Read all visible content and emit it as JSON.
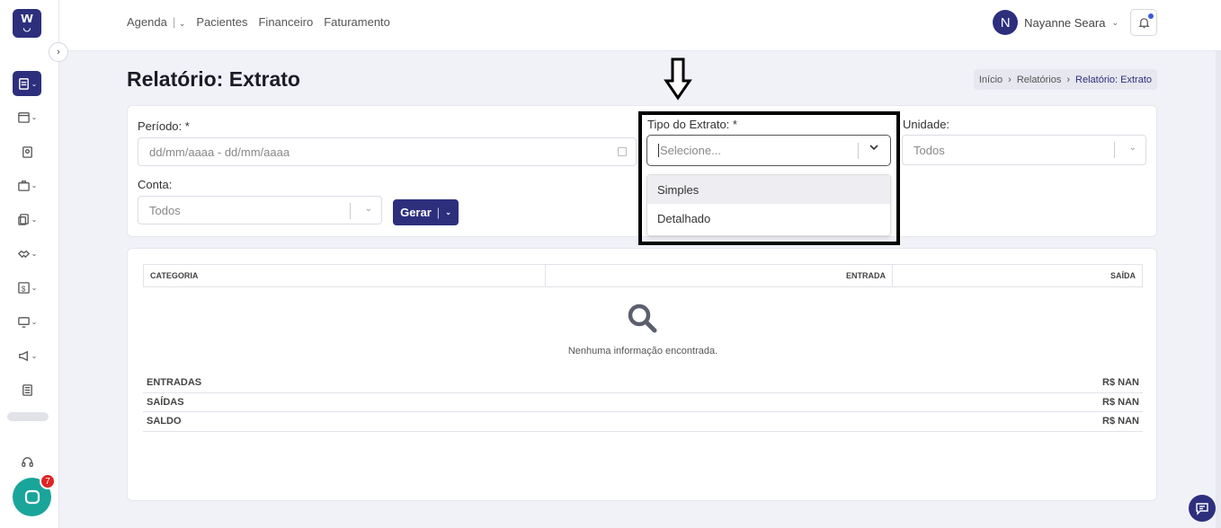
{
  "app": {
    "logo_text": "w",
    "brand_color": "#2d2f7d"
  },
  "nav": {
    "items": [
      "Agenda",
      "Pacientes",
      "Financeiro",
      "Faturamento"
    ]
  },
  "user": {
    "initial": "N",
    "name": "Nayanne Seara"
  },
  "page": {
    "title": "Relatório: Extrato"
  },
  "breadcrumb": [
    "Início",
    "Relatórios",
    "Relatório: Extrato"
  ],
  "filters": {
    "periodo_label": "Período: *",
    "periodo_placeholder": "dd/mm/aaaa - dd/mm/aaaa",
    "conta_label": "Conta:",
    "conta_value": "Todos",
    "tipo_label": "Tipo do Extrato: *",
    "tipo_placeholder": "Selecione...",
    "tipo_options": [
      "Simples",
      "Detalhado"
    ],
    "unidade_label": "Unidade:",
    "unidade_value": "Todos",
    "gerar_label": "Gerar"
  },
  "table": {
    "columns": [
      "CATEGORIA",
      "ENTRADA",
      "SAÍDA"
    ],
    "empty_text": "Nenhuma informação encontrada.",
    "totals": [
      {
        "label": "ENTRADAS",
        "value": "R$ NAN"
      },
      {
        "label": "SAÍDAS",
        "value": "R$ NAN"
      },
      {
        "label": "SALDO",
        "value": "R$ NAN"
      }
    ]
  },
  "chat": {
    "badge_count": "7"
  }
}
